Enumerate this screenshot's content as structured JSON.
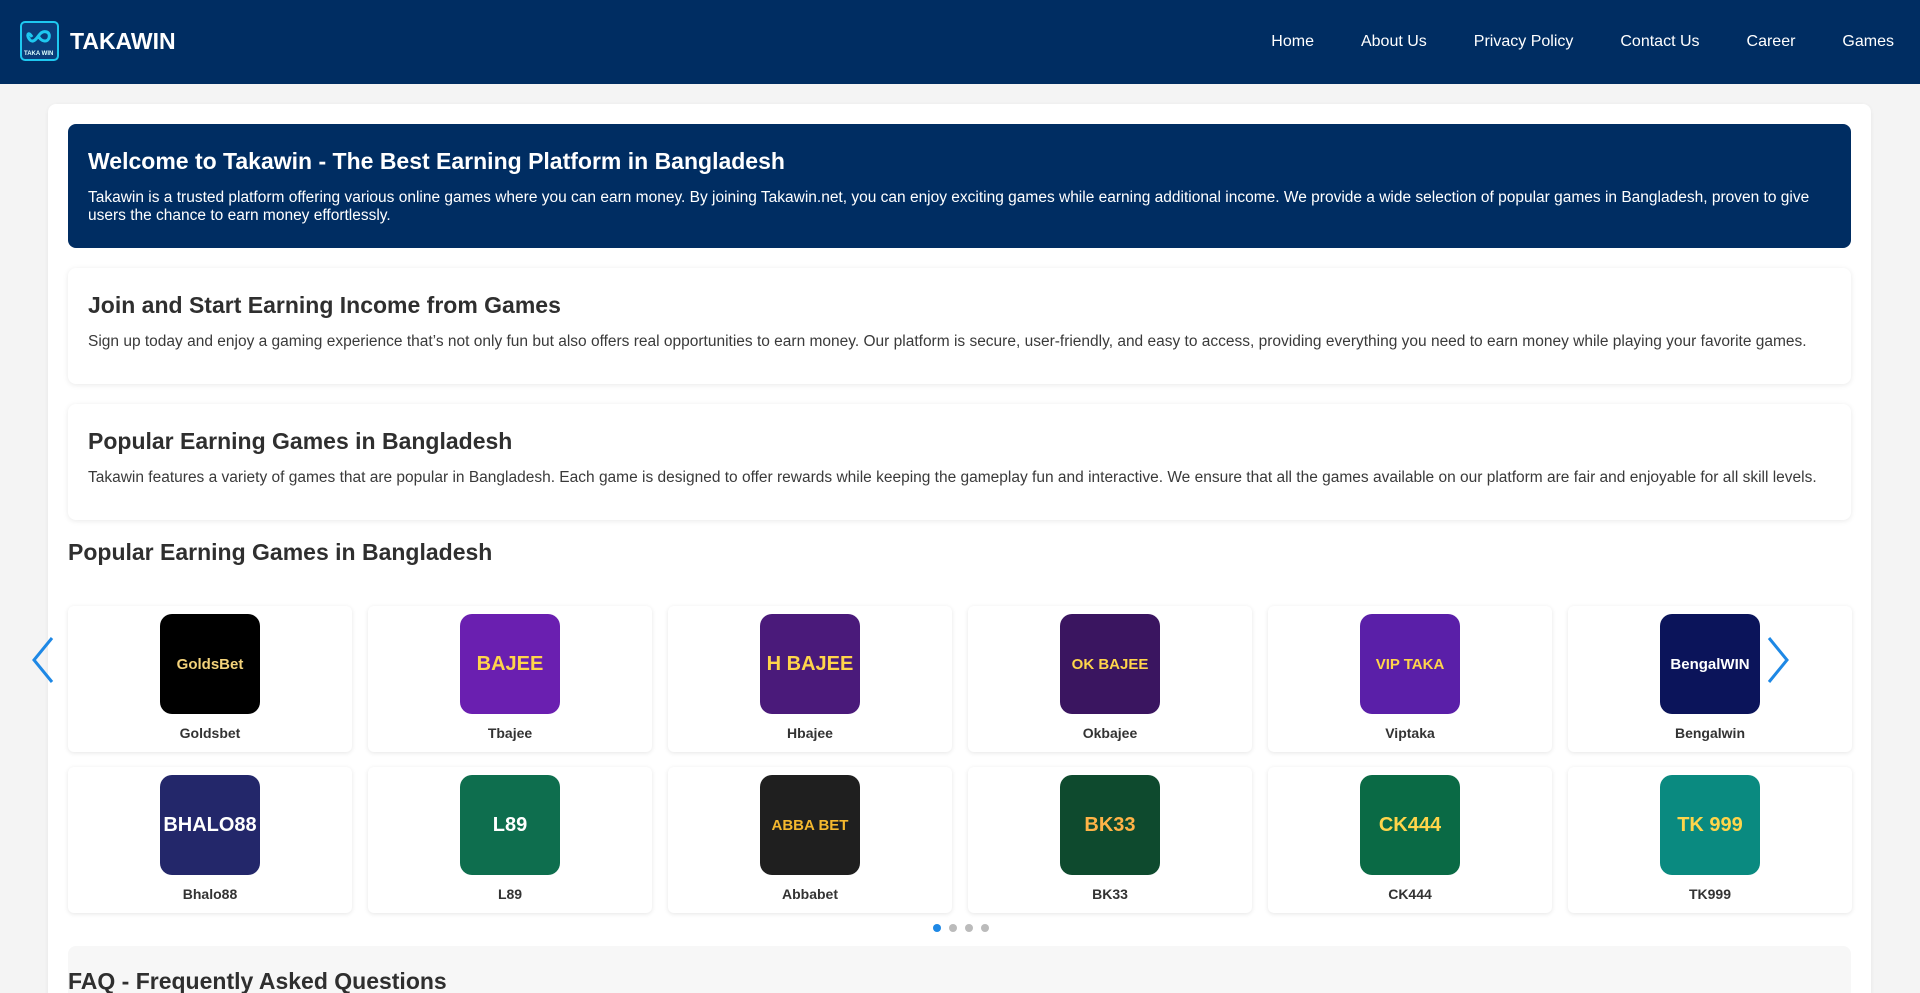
{
  "brand": {
    "name": "TAKAWIN",
    "logo_text": "TAKA WIN"
  },
  "nav": {
    "items": [
      "Home",
      "About Us",
      "Privacy Policy",
      "Contact Us",
      "Career",
      "Games"
    ]
  },
  "hero": {
    "title": "Welcome to Takawin - The Best Earning Platform in Bangladesh",
    "text": "Takawin is a trusted platform offering various online games where you can earn money. By joining Takawin.net, you can enjoy exciting games while earning additional income. We provide a wide selection of popular games in Bangladesh, proven to give users the chance to earn money effortlessly."
  },
  "join": {
    "title": "Join and Start Earning Income from Games",
    "text": "Sign up today and enjoy a gaming experience that’s not only fun but also offers real opportunities to earn money. Our platform is secure, user-friendly, and easy to access, providing everything you need to earn money while playing your favorite games."
  },
  "popular": {
    "title": "Popular Earning Games in Bangladesh",
    "text": "Takawin features a variety of games that are popular in Bangladesh. Each game is designed to offer rewards while keeping the gameplay fun and interactive. We ensure that all the games available on our platform are fair and enjoyable for all skill levels."
  },
  "games_section": {
    "title": "Popular Earning Games in Bangladesh"
  },
  "games": [
    {
      "name": "Goldsbet",
      "logo": "GoldsBet",
      "bg": "#000000",
      "fg": "#f3d27a"
    },
    {
      "name": "Tbajee",
      "logo": "BAJEE",
      "bg": "#6a1fb0",
      "fg": "#ffd54a"
    },
    {
      "name": "Hbajee",
      "logo": "H BAJEE",
      "bg": "#4a1a7a",
      "fg": "#ffd54a"
    },
    {
      "name": "Okbajee",
      "logo": "OK BAJEE",
      "bg": "#3a1560",
      "fg": "#ffd54a"
    },
    {
      "name": "Viptaka",
      "logo": "VIP TAKA",
      "bg": "#5a1fa8",
      "fg": "#ffd54a"
    },
    {
      "name": "Bengalwin",
      "logo": "BengalWIN",
      "bg": "#0b145a",
      "fg": "#ffffff"
    },
    {
      "name": "Bhalo88",
      "logo": "BHALO88",
      "bg": "#23276a",
      "fg": "#ffffff"
    },
    {
      "name": "L89",
      "logo": "L89",
      "bg": "#0e6e4e",
      "fg": "#ffffff"
    },
    {
      "name": "Abbabet",
      "logo": "ABBA BET",
      "bg": "#1f1f1f",
      "fg": "#f5b82e"
    },
    {
      "name": "BK33",
      "logo": "BK33",
      "bg": "#0e4a2e",
      "fg": "#ffb347"
    },
    {
      "name": "CK444",
      "logo": "CK444",
      "bg": "#0a6a45",
      "fg": "#ffd54a"
    },
    {
      "name": "TK999",
      "logo": "TK 999",
      "bg": "#0a8a80",
      "fg": "#ffd54a"
    }
  ],
  "carousel": {
    "pages": 4,
    "active": 0
  },
  "faq": {
    "title": "FAQ - Frequently Asked Questions"
  },
  "colors": {
    "header": "#002d62",
    "accent": "#1e88e5"
  }
}
